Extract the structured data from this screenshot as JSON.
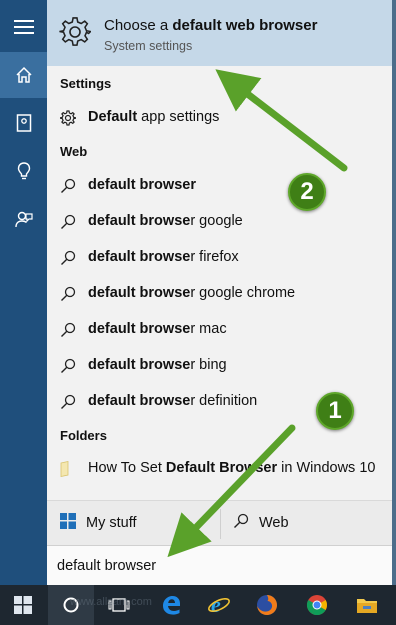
{
  "top_result": {
    "title_prefix": "Choose a ",
    "title_bold": "default web browser",
    "subtitle": "System settings",
    "icon": "gear-icon"
  },
  "sections": {
    "settings": "Settings",
    "web": "Web",
    "folders": "Folders"
  },
  "settings_item": {
    "bold": "Default",
    "rest": " app settings",
    "icon": "gear-icon"
  },
  "web_results": [
    {
      "bold": "default browser",
      "rest": ""
    },
    {
      "bold": "default browse",
      "rest": "r google"
    },
    {
      "bold": "default browse",
      "rest": "r firefox"
    },
    {
      "bold": "default browse",
      "rest": "r google chrome"
    },
    {
      "bold": "default browse",
      "rest": "r mac"
    },
    {
      "bold": "default browse",
      "rest": "r bing"
    },
    {
      "bold": "default browse",
      "rest": "r definition"
    }
  ],
  "folder_item": {
    "pre": "How To Set ",
    "bold": "Default Browser",
    "post": " in Windows 10",
    "icon": "folder-icon"
  },
  "bottom_bar": {
    "my_stuff": "My stuff",
    "web": "Web"
  },
  "search": {
    "value": "default browser"
  },
  "annotations": {
    "badge_1": "1",
    "badge_2": "2",
    "arrow_color": "#5aa12a"
  },
  "rail_icons": [
    "hamburger-icon",
    "home-icon",
    "notebook-icon",
    "lightbulb-icon",
    "feedback-icon"
  ],
  "taskbar_icons": [
    "windows-start-icon",
    "cortana-circle-icon",
    "task-view-icon",
    "edge-icon",
    "internet-explorer-icon",
    "firefox-icon",
    "chrome-icon",
    "file-explorer-icon"
  ],
  "watermark": "www.allsam.com"
}
